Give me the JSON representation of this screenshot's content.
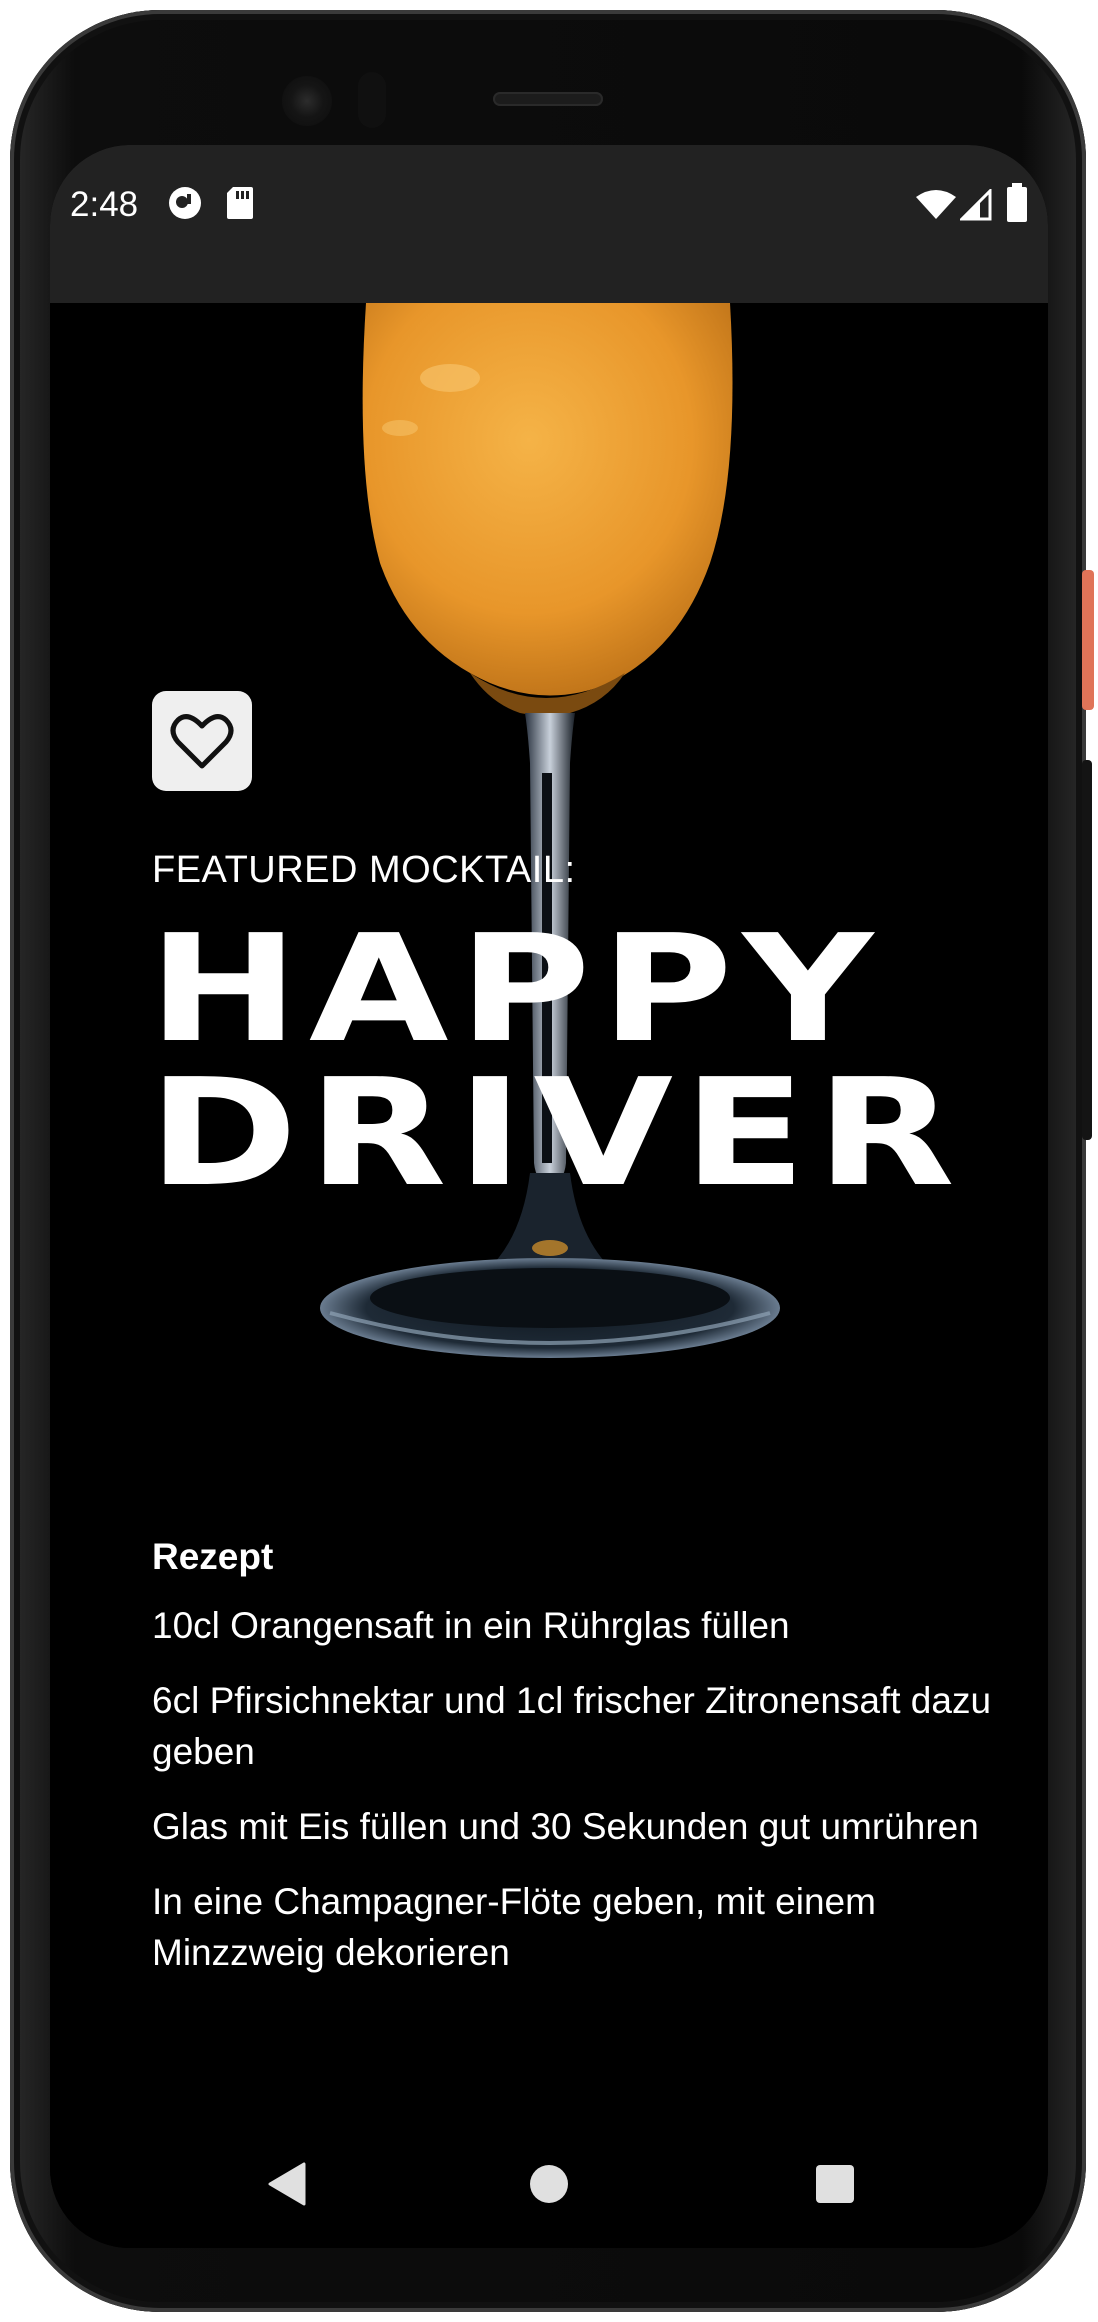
{
  "status_bar": {
    "time": "2:48",
    "background": "#222222"
  },
  "mocktail": {
    "kicker": "FEATURED MOCKTAIL:",
    "title_line1": "HAPPY",
    "title_line2": "DRIVER",
    "drink_color": "#f0a030"
  },
  "recipe": {
    "heading": "Rezept",
    "steps": [
      "10cl Orangensaft in ein Rührglas füllen",
      "6cl Pfirsichnektar und 1cl frischer Zitronensaft dazu geben",
      "Glas mit Eis füllen und 30 Sekunden gut umrühren",
      "In eine Champagner-Flöte geben, mit einem Minzzweig dekorieren"
    ]
  },
  "icons": {
    "favorite": "heart-outline-icon",
    "nav_back": "triangle-back-icon",
    "nav_home": "circle-home-icon",
    "nav_recents": "square-recents-icon"
  }
}
